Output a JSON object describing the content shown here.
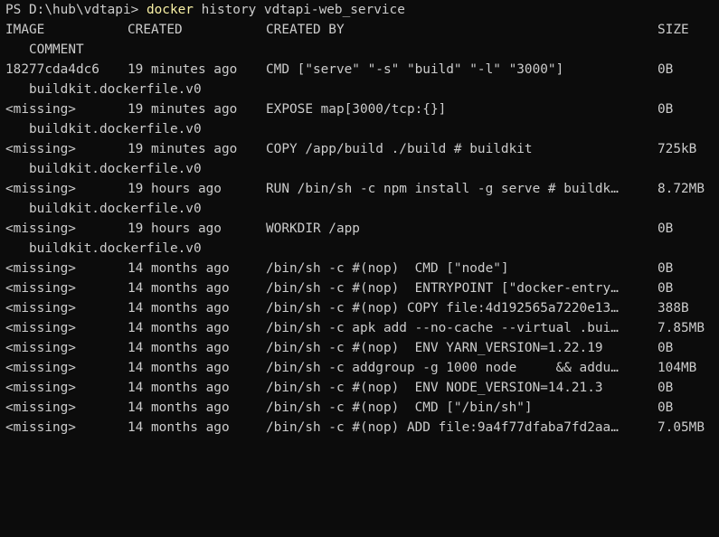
{
  "terminal": {
    "prompt": "PS D:\\hub\\vdtapi>",
    "command_name": "docker",
    "command_args": "history vdtapi-web_service"
  },
  "table": {
    "headers": {
      "image": "IMAGE",
      "created": "CREATED",
      "created_by": "CREATED BY",
      "size": "SIZE",
      "comment": "COMMENT"
    },
    "rows": [
      {
        "image": "18277cda4dc6",
        "created": "19 minutes ago",
        "created_by": "CMD [\"serve\" \"-s\" \"build\" \"-l\" \"3000\"]",
        "size": "0B",
        "comment": "buildkit.dockerfile.v0"
      },
      {
        "image": "<missing>",
        "created": "19 minutes ago",
        "created_by": "EXPOSE map[3000/tcp:{}]",
        "size": "0B",
        "comment": "buildkit.dockerfile.v0"
      },
      {
        "image": "<missing>",
        "created": "19 minutes ago",
        "created_by": "COPY /app/build ./build # buildkit",
        "size": "725kB",
        "comment": "buildkit.dockerfile.v0"
      },
      {
        "image": "<missing>",
        "created": "19 hours ago",
        "created_by": "RUN /bin/sh -c npm install -g serve # buildk…",
        "size": "8.72MB",
        "comment": "buildkit.dockerfile.v0"
      },
      {
        "image": "<missing>",
        "created": "19 hours ago",
        "created_by": "WORKDIR /app",
        "size": "0B",
        "comment": "buildkit.dockerfile.v0"
      },
      {
        "image": "<missing>",
        "created": "14 months ago",
        "created_by": "/bin/sh -c #(nop)  CMD [\"node\"]",
        "size": "0B",
        "comment": ""
      },
      {
        "image": "<missing>",
        "created": "14 months ago",
        "created_by": "/bin/sh -c #(nop)  ENTRYPOINT [\"docker-entry…",
        "size": "0B",
        "comment": ""
      },
      {
        "image": "<missing>",
        "created": "14 months ago",
        "created_by": "/bin/sh -c #(nop) COPY file:4d192565a7220e13…",
        "size": "388B",
        "comment": ""
      },
      {
        "image": "<missing>",
        "created": "14 months ago",
        "created_by": "/bin/sh -c apk add --no-cache --virtual .bui…",
        "size": "7.85MB",
        "comment": ""
      },
      {
        "image": "<missing>",
        "created": "14 months ago",
        "created_by": "/bin/sh -c #(nop)  ENV YARN_VERSION=1.22.19",
        "size": "0B",
        "comment": ""
      },
      {
        "image": "<missing>",
        "created": "14 months ago",
        "created_by": "/bin/sh -c addgroup -g 1000 node     && addu…",
        "size": "104MB",
        "comment": ""
      },
      {
        "image": "<missing>",
        "created": "14 months ago",
        "created_by": "/bin/sh -c #(nop)  ENV NODE_VERSION=14.21.3",
        "size": "0B",
        "comment": ""
      },
      {
        "image": "<missing>",
        "created": "14 months ago",
        "created_by": "/bin/sh -c #(nop)  CMD [\"/bin/sh\"]",
        "size": "0B",
        "comment": ""
      },
      {
        "image": "<missing>",
        "created": "14 months ago",
        "created_by": "/bin/sh -c #(nop) ADD file:9a4f77dfaba7fd2aa…",
        "size": "7.05MB",
        "comment": ""
      }
    ]
  },
  "colors": {
    "background": "#0c0c0c",
    "text": "#cccccc",
    "command": "#f9f1a5"
  }
}
